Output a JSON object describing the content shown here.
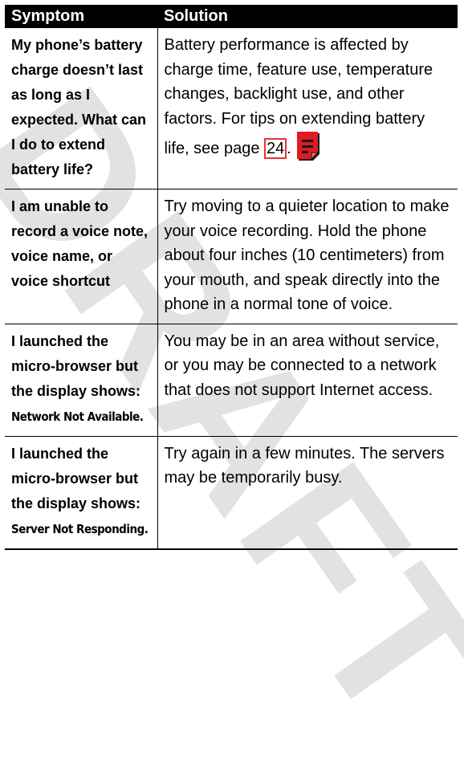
{
  "watermark": "DRAFT",
  "headers": {
    "symptom": "Symptom",
    "solution": "Solution"
  },
  "rows": [
    {
      "symptom": "My phone’s battery charge doesn’t last as long as I expected. What can I do to extend battery life?",
      "solution": "Battery performance is affected by charge time, feature use, temperature changes, backlight use, and other factors. For tips on extending battery life, see page",
      "page_ref": "24",
      "after_ref": "."
    },
    {
      "symptom": "I am unable to record a voice note, voice name, or voice shortcut",
      "solution": "Try moving to a quieter location to make your voice recording. Hold the phone about four inches (10 centimeters) from your mouth, and speak directly into the phone in a normal tone of voice."
    },
    {
      "symptom": "I launched the micro-browser but the display shows:",
      "display_text": "Network Not Available.",
      "solution": "You may be in an area without service, or you may be connected to a network that does not support Internet access."
    },
    {
      "symptom": "I launched the micro-browser but the display shows:",
      "display_text": "Server Not Responding.",
      "solution": "Try again in a few minutes. The servers may be temporarily busy."
    }
  ],
  "colors": {
    "header_bg": "#000000",
    "link_border": "#e53333",
    "note_icon": "#e01b24",
    "watermark": "#d6d6d6"
  },
  "icons": [
    "note-icon"
  ]
}
